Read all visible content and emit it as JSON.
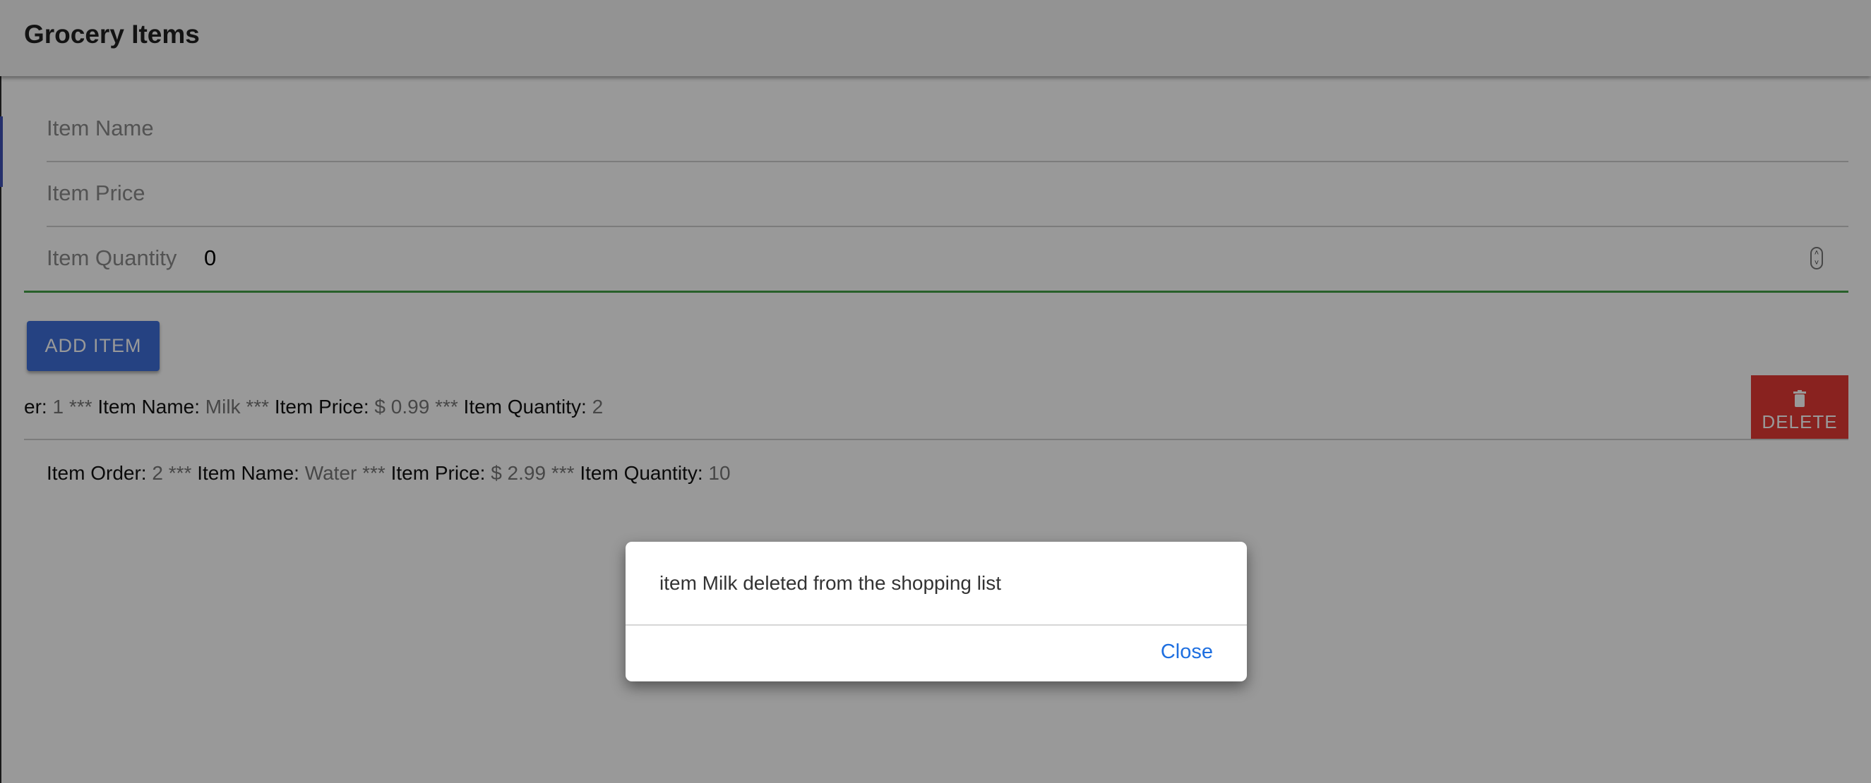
{
  "toolbar": {
    "title": "Grocery Items"
  },
  "form": {
    "name_label": "Item Name",
    "price_label": "Item Price",
    "quantity_label": "Item Quantity",
    "quantity_value": "0",
    "add_label": "ADD ITEM"
  },
  "items": [
    {
      "order_label_partial": "er:",
      "order": "1",
      "name_label": "Item Name:",
      "name": "Milk",
      "price_label": "Item Price:",
      "price": "$ 0.99",
      "quantity_label": "Item Quantity:",
      "quantity": "2",
      "delete_label": "DELETE"
    },
    {
      "order_label": "Item Order:",
      "order": "2",
      "name_label": "Item Name:",
      "name": "Water",
      "price_label": "Item Price:",
      "price": "$ 2.99",
      "quantity_label": "Item Quantity:",
      "quantity": "10"
    }
  ],
  "separator": "***",
  "dialog": {
    "message": "item Milk deleted from the shopping list",
    "close_label": "Close"
  },
  "colors": {
    "primary": "#3f6fd9",
    "delete": "#e53935",
    "focus": "#43a047",
    "link": "#1e6fe0"
  }
}
